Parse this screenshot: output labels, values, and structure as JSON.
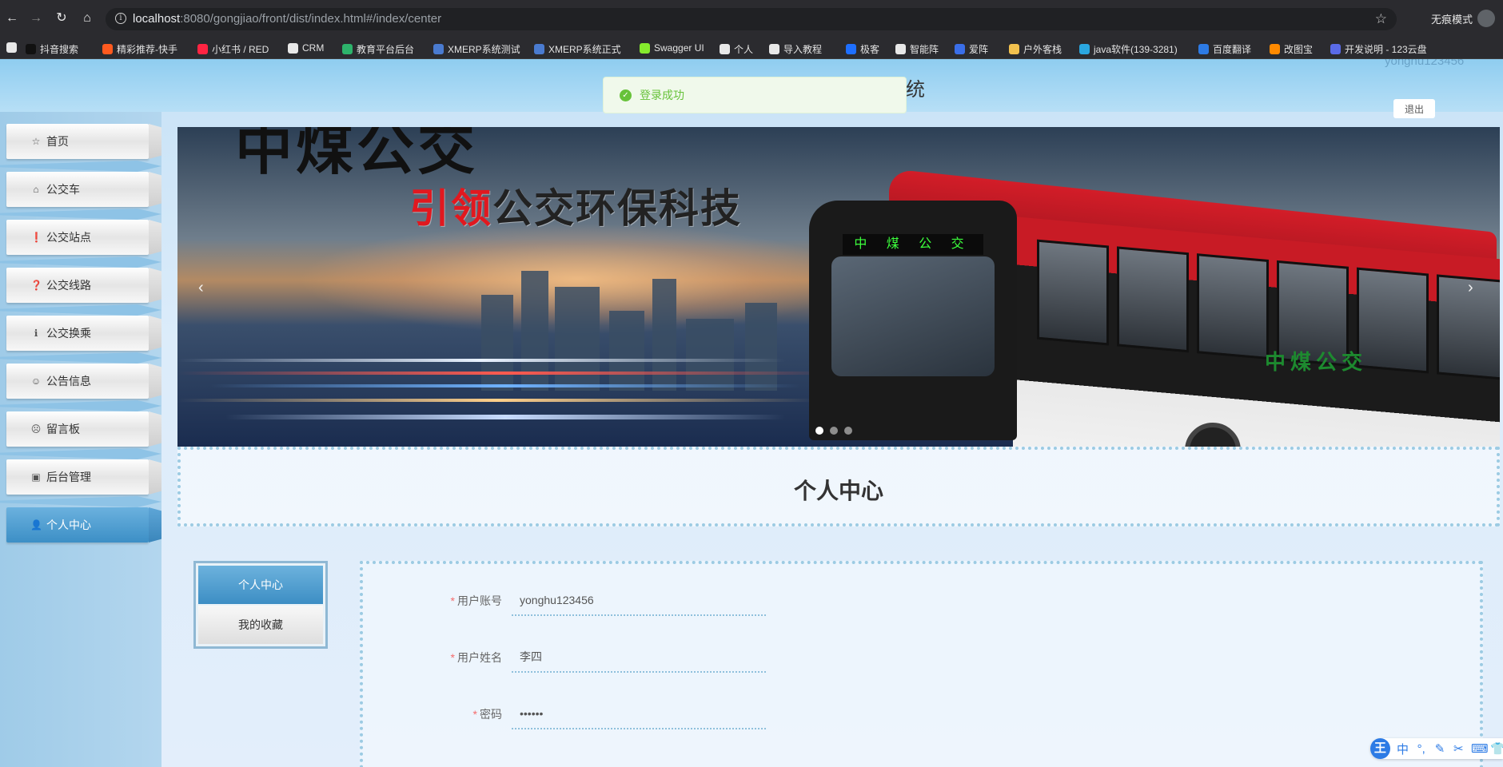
{
  "browser": {
    "url_host": "localhost",
    "url_rest": ":8080/gongjiao/front/dist/index.html#/index/center",
    "incognito_label": "无痕模式",
    "bookmarks": [
      {
        "label": "抖音搜索",
        "color": "#111111"
      },
      {
        "label": "精彩推荐-快手",
        "color": "#ff5a1f"
      },
      {
        "label": "小红书 / RED",
        "color": "#ff2442"
      },
      {
        "label": "CRM",
        "color": "#e8e8e8"
      },
      {
        "label": "教育平台后台",
        "color": "#2db36b"
      },
      {
        "label": "XMERP系统测试",
        "color": "#4a7bd0"
      },
      {
        "label": "XMERP系统正式",
        "color": "#4a7bd0"
      },
      {
        "label": "Swagger UI",
        "color": "#85ea2d"
      },
      {
        "label": "个人",
        "color": "#e8e8e8"
      },
      {
        "label": "导入教程",
        "color": "#e8e8e8"
      },
      {
        "label": "极客",
        "color": "#1e6fff"
      },
      {
        "label": "智能阵",
        "color": "#e8e8e8"
      },
      {
        "label": "爱阵",
        "color": "#3a6ee8"
      },
      {
        "label": "户外客栈",
        "color": "#f2c14e"
      },
      {
        "label": "java软件(139-3281)",
        "color": "#2aa7e0"
      },
      {
        "label": "百度翻译",
        "color": "#2d7be5"
      },
      {
        "label": "改图宝",
        "color": "#ff8a00"
      },
      {
        "label": "开发说明 - 123云盘",
        "color": "#5a6be8"
      }
    ]
  },
  "header": {
    "user_name": "yonghu123456",
    "site_title_fragment": "统",
    "logout_label": "退出"
  },
  "toast": {
    "message": "登录成功"
  },
  "sidebar": {
    "items": [
      {
        "label": "首页",
        "icon": "star-icon",
        "glyph": "☆"
      },
      {
        "label": "公交车",
        "icon": "bag-icon",
        "glyph": "⌂"
      },
      {
        "label": "公交站点",
        "icon": "alert-circle-icon",
        "glyph": "❗"
      },
      {
        "label": "公交线路",
        "icon": "question-circle-icon",
        "glyph": "❓"
      },
      {
        "label": "公交换乘",
        "icon": "info-circle-icon",
        "glyph": "ℹ"
      },
      {
        "label": "公告信息",
        "icon": "smile-icon",
        "glyph": "☺"
      },
      {
        "label": "留言板",
        "icon": "chat-icon",
        "glyph": "☹"
      },
      {
        "label": "后台管理",
        "icon": "briefcase-icon",
        "glyph": "▣"
      },
      {
        "label": "个人中心",
        "icon": "user-icon",
        "glyph": "👤"
      }
    ],
    "active_index": 8
  },
  "banner": {
    "title_top": "中煤公交",
    "slogan_red": "引领",
    "slogan_rest": "公交环保科技",
    "bus_sign": "中 煤 公 交",
    "bus_logo": "中煤公交",
    "slides": 3,
    "current_slide": 1,
    "prev_glyph": "‹",
    "next_glyph": "›"
  },
  "section": {
    "title": "个人中心"
  },
  "sub_menu": {
    "items": [
      "个人中心",
      "我的收藏"
    ],
    "active_index": 0
  },
  "form": {
    "fields": [
      {
        "label": "用户账号",
        "value": "yonghu123456",
        "required": true,
        "type": "text"
      },
      {
        "label": "用户姓名",
        "value": "李四",
        "required": true,
        "type": "text"
      },
      {
        "label": "密码",
        "value": "••••••",
        "required": true,
        "type": "password"
      }
    ]
  },
  "ime": {
    "logo": "王",
    "buttons": [
      {
        "name": "chinese-mode-icon",
        "glyph": "中"
      },
      {
        "name": "punctuation-icon",
        "glyph": "°,"
      },
      {
        "name": "pen-icon",
        "glyph": "✎"
      },
      {
        "name": "scissors-icon",
        "glyph": "✂"
      },
      {
        "name": "keyboard-icon",
        "glyph": "⌨"
      },
      {
        "name": "skin-icon",
        "glyph": "👕"
      }
    ]
  }
}
